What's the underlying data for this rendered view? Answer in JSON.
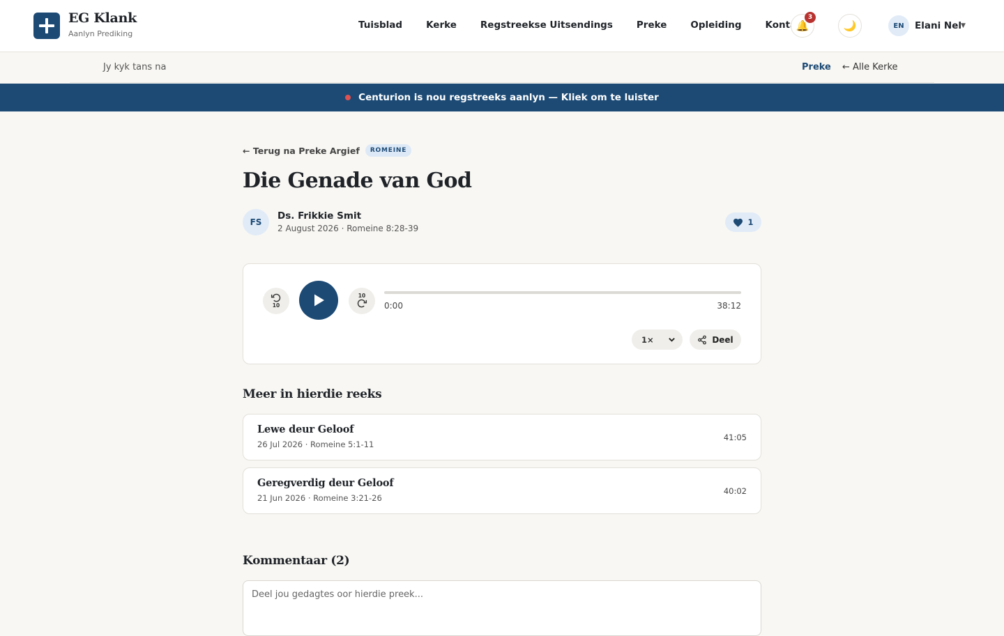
{
  "header": {
    "brand_name": "EG Klank",
    "brand_sub": "Aanlyn Prediking",
    "nav": [
      "Tuisblad",
      "Kerke",
      "Regstreekse Uitsendings",
      "Preke",
      "Opleiding",
      "Kontak"
    ],
    "notifications_count": "3",
    "user_initials": "EN",
    "user_name": "Elani Nel"
  },
  "subbar": {
    "watching_label": "Jy kyk tans na",
    "current": "Preke",
    "all_churches": "← Alle Kerke"
  },
  "live_banner": {
    "text": "Centurion is nou regstreeks aanlyn — Kliek om te luister",
    "dot_color": "#e05252"
  },
  "sermon": {
    "back_link": "← Terug na Preke Argief",
    "tag": "ROMEINE",
    "title": "Die Genade van God",
    "speaker_initials": "FS",
    "speaker": "Ds. Frikkie Smit",
    "meta": "2 August 2026 · Romeine 8:28-39",
    "likes": "1"
  },
  "player": {
    "skip_back": "10",
    "skip_forward": "10",
    "current_time": "0:00",
    "duration": "38:12",
    "progress": 0,
    "speed": "1×",
    "share_label": "Deel"
  },
  "series": {
    "heading": "Meer in hierdie reeks",
    "items": [
      {
        "title": "Lewe deur Geloof",
        "meta": "26 Jul 2026 · Romeine 5:1-11",
        "duration": "41:05"
      },
      {
        "title": "Geregverdig deur Geloof",
        "meta": "21 Jun 2026 · Romeine 3:21-26",
        "duration": "40:02"
      }
    ]
  },
  "comments": {
    "heading": "Kommentaar (2)",
    "placeholder": "Deel jou gedagtes oor hierdie preek..."
  },
  "colors": {
    "primary": "#1c4a75",
    "background": "#f8f7f3",
    "badge": "#b8322f"
  }
}
